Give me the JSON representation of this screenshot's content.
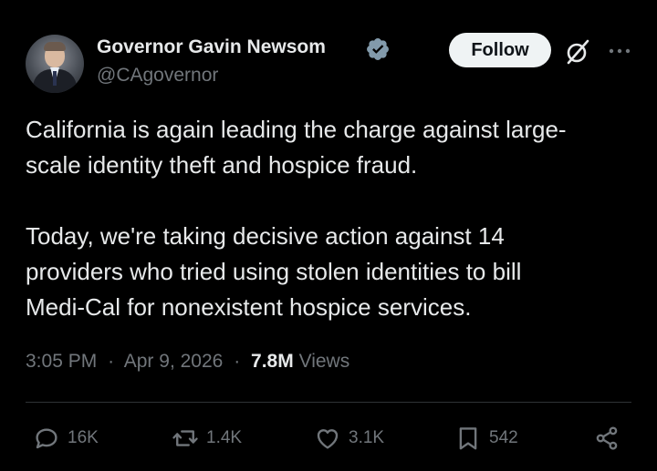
{
  "author": {
    "name": "Governor Gavin Newsom",
    "handle": "@CAgovernor",
    "verified": true,
    "verified_color": "#829aab"
  },
  "header": {
    "follow_label": "Follow",
    "grok_icon": "grok-slash-circle-icon",
    "more_icon": "more-horizontal-icon"
  },
  "tweet": {
    "paragraph1_line1": "California is again leading the charge against large-",
    "paragraph1_line2": "scale identity theft and hospice fraud.",
    "paragraph2_line1": "Today, we're taking decisive action against 14",
    "paragraph2_line2": "providers who tried using stolen identities to bill",
    "paragraph2_line3": "Medi-Cal for nonexistent hospice services."
  },
  "meta": {
    "time": "3:05 PM",
    "separator": "·",
    "date": "Apr 9, 2026",
    "views_count": "7.8M",
    "views_label": "Views"
  },
  "actions": {
    "replies": "16K",
    "reposts": "1.4K",
    "likes": "3.1K",
    "bookmarks": "542"
  },
  "colors": {
    "background": "#000000",
    "text": "#e7e9ea",
    "secondary": "#71767b",
    "follow_bg": "#eff3f4"
  }
}
